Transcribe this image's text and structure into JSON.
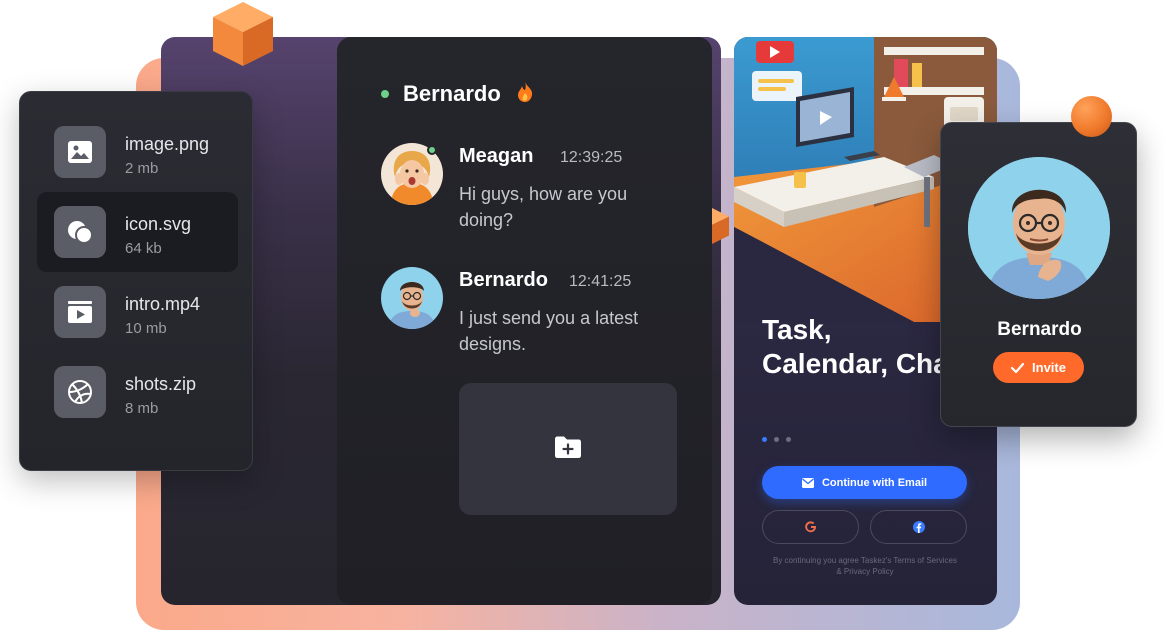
{
  "files": {
    "items": [
      {
        "name": "image.png",
        "size": "2 mb",
        "icon": "image-icon",
        "active": false
      },
      {
        "name": "icon.svg",
        "size": "64 kb",
        "icon": "circles-icon",
        "active": true
      },
      {
        "name": "intro.mp4",
        "size": "10 mb",
        "icon": "video-icon",
        "active": false
      },
      {
        "name": "shots.zip",
        "size": "8 mb",
        "icon": "dribbble-icon",
        "active": false
      }
    ]
  },
  "chat": {
    "title": "Bernardo",
    "status_icon": "fire-icon",
    "messages": [
      {
        "author": "Meagan",
        "time": "12:39:25",
        "text": "Hi guys, how are you doing?",
        "online": true
      },
      {
        "author": "Bernardo",
        "time": "12:41:25",
        "text": "I just send you a latest designs.",
        "online": false
      }
    ],
    "attachment_icon": "folder-add-icon"
  },
  "app": {
    "headline": "Task, Calendar, Chat",
    "email_button": "Continue with Email",
    "social": [
      "google-icon",
      "facebook-icon"
    ],
    "terms": "By continuing you agree Taskez's Terms of Services & Privacy Policy",
    "pager_active": 1,
    "pager_count": 3
  },
  "profile": {
    "name": "Bernardo",
    "invite_label": "Invite"
  },
  "colors": {
    "accent_blue": "#2f6bff",
    "accent_orange": "#ff6a2b",
    "online_green": "#6ed08a"
  }
}
